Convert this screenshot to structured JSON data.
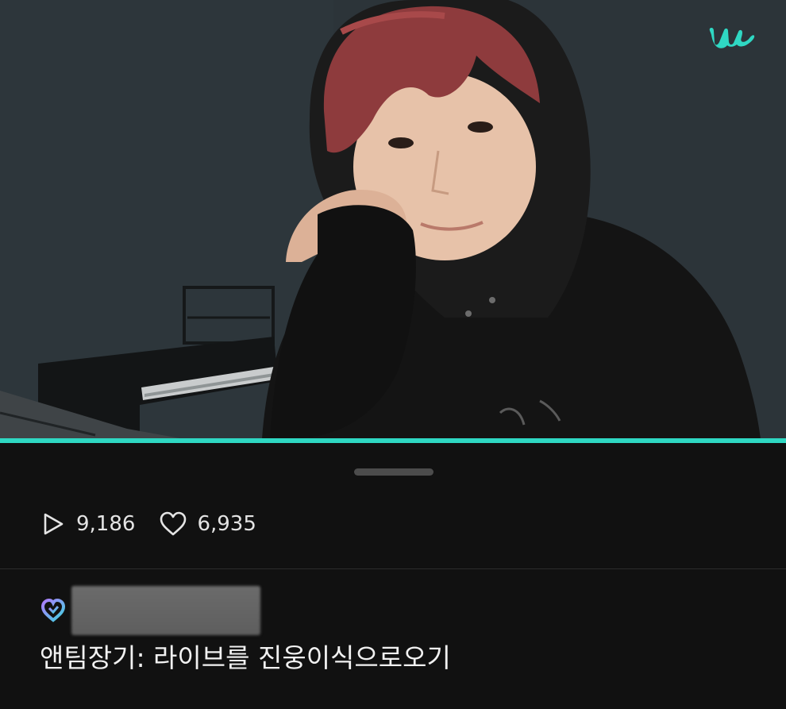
{
  "video": {
    "thumbnail_icon": "live-video-frame",
    "brand_icon": "weverse-logo-icon",
    "brand_color": "#2fd8c3",
    "progress_fraction": 1.0
  },
  "stats": {
    "plays_icon": "play-icon",
    "plays": "9,186",
    "likes_icon": "heart-icon",
    "likes": "6,935"
  },
  "post": {
    "author_icon": "artist-badge-icon",
    "title": "앤팀장기: 라이브를 진웅이식으로오기"
  }
}
